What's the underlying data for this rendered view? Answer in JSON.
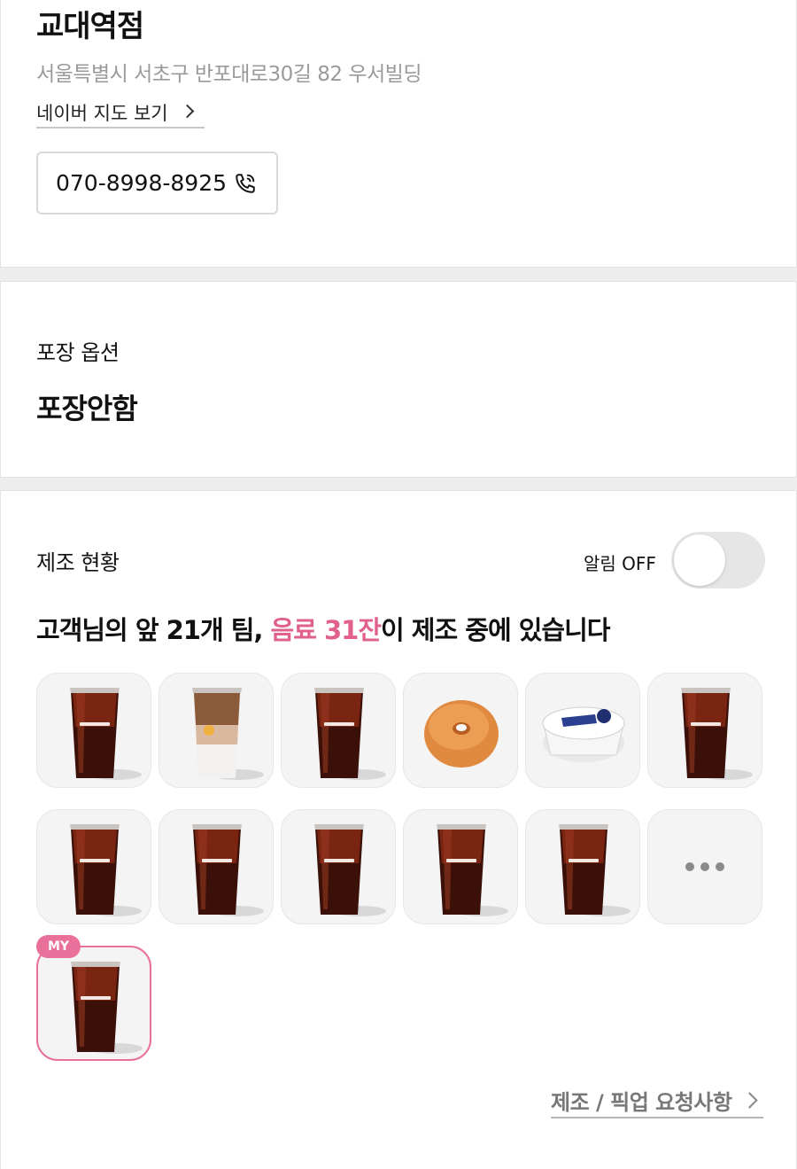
{
  "store": {
    "name": "교대역점",
    "address": "서울특별시 서초구 반포대로30길 82 우서빌딩",
    "map_link_label": "네이버 지도 보기",
    "phone": "070-8998-8925"
  },
  "packaging": {
    "label": "포장 옵션",
    "value": "포장안함"
  },
  "status": {
    "title": "제조 현황",
    "notification_label": "알림 OFF",
    "notification_on": false,
    "queue_message_prefix": "고객님의 앞 21개 팀, ",
    "queue_message_highlight": "음료 31잔",
    "queue_message_suffix": "이 제조 중에 있습니다",
    "items": [
      {
        "icon": "iced-americano-icon"
      },
      {
        "icon": "iced-latte-icon"
      },
      {
        "icon": "iced-americano-icon"
      },
      {
        "icon": "bagel-icon"
      },
      {
        "icon": "cream-cheese-cup-icon"
      },
      {
        "icon": "iced-americano-icon"
      },
      {
        "icon": "iced-americano-icon"
      },
      {
        "icon": "iced-americano-icon"
      },
      {
        "icon": "iced-americano-icon"
      },
      {
        "icon": "iced-americano-icon"
      },
      {
        "icon": "iced-americano-icon"
      },
      {
        "icon": "more-icon"
      }
    ],
    "my_item": {
      "badge": "MY",
      "icon": "iced-americano-icon"
    },
    "request_link_label": "제조 / 픽업 요청사항"
  },
  "colors": {
    "accent": "#e0608e",
    "badge": "#e8709a"
  }
}
